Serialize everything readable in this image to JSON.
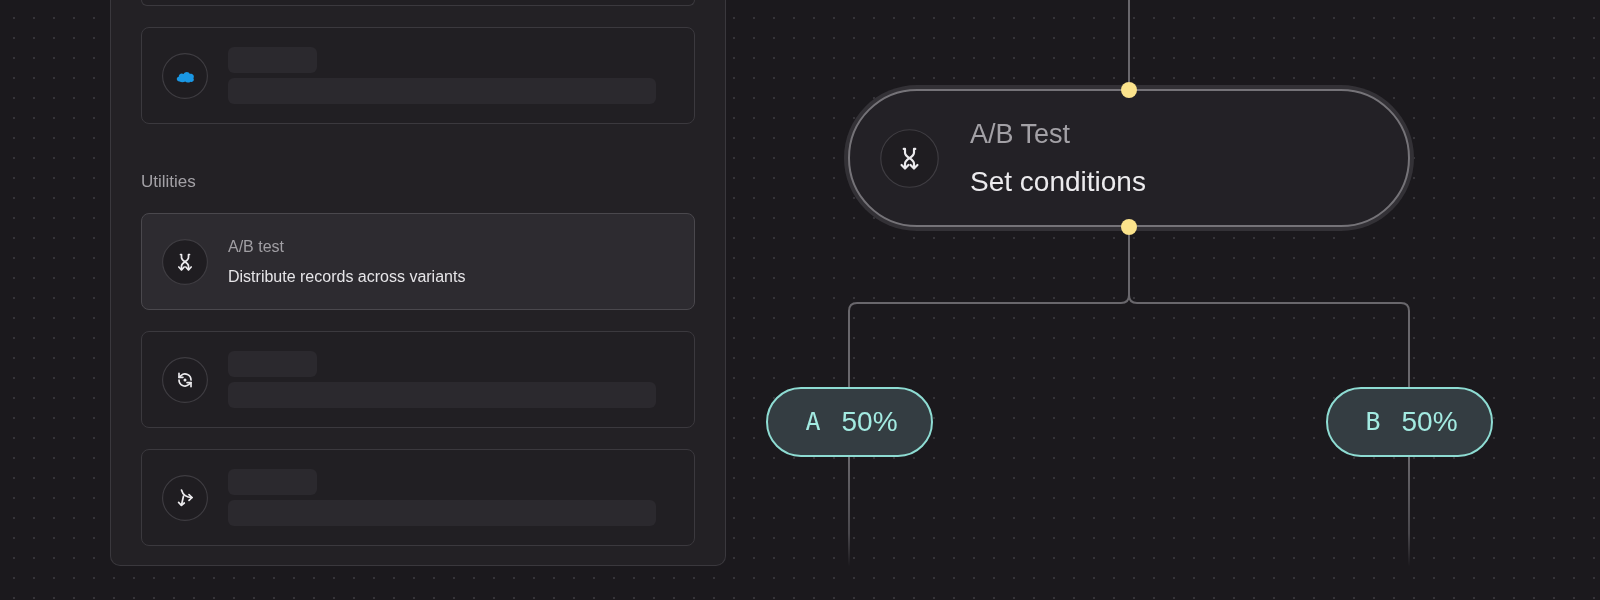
{
  "sidebar": {
    "sections": [
      {
        "items": [
          {
            "kind": "clipped",
            "selected": false
          },
          {
            "kind": "skeleton",
            "selected": false
          }
        ]
      },
      {
        "label": "Utilities",
        "items": [
          {
            "kind": "text",
            "title": "A/B test",
            "description": "Distribute records across variants",
            "selected": true
          },
          {
            "kind": "skeleton",
            "selected": false
          },
          {
            "kind": "skeleton",
            "selected": false
          }
        ]
      }
    ]
  },
  "canvas": {
    "node": {
      "title": "A/B Test",
      "subtitle": "Set conditions"
    },
    "branches": [
      {
        "letter": "A",
        "share": "50%"
      },
      {
        "letter": "B",
        "share": "50%"
      }
    ]
  }
}
